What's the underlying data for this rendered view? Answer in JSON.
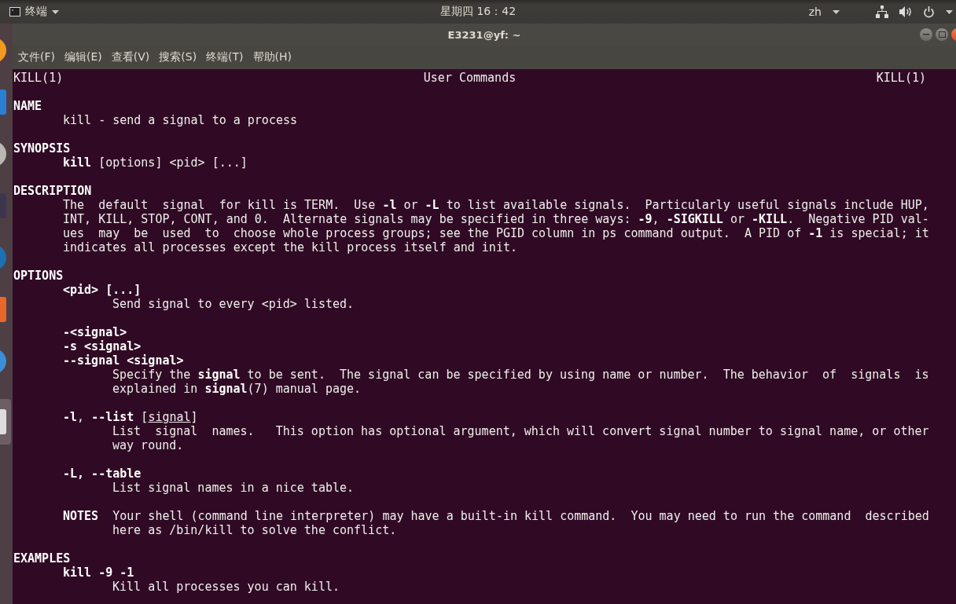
{
  "topbar": {
    "app_menu": "终端",
    "clock": "星期四 16：42",
    "language": "zh"
  },
  "dock": [
    {
      "selected": false
    },
    {
      "selected": false
    },
    {
      "selected": false
    },
    {
      "selected": false
    },
    {
      "selected": false
    },
    {
      "selected": false
    },
    {
      "selected": false
    },
    {
      "selected": true
    }
  ],
  "window": {
    "title": "E3231@yf: ~"
  },
  "menu": [
    "文件(F)",
    "编辑(E)",
    "查看(V)",
    "搜索(S)",
    "终端(T)",
    "帮助(H)"
  ],
  "man": {
    "header": {
      "left": "KILL(1)",
      "center": "User Commands",
      "right": "KILL(1)"
    },
    "sections": [
      {
        "heading": "NAME",
        "blocks": [
          {
            "lines": [
              {
                "kind": "term",
                "bold": false,
                "text": "kill - send a signal to a process"
              }
            ]
          }
        ]
      },
      {
        "heading": "SYNOPSIS",
        "blocks": [
          {
            "lines": [
              {
                "kind": "term",
                "bold": false,
                "text": "**kill** [options] <pid> [...]"
              }
            ]
          }
        ]
      },
      {
        "heading": "DESCRIPTION",
        "blocks": [
          {
            "lines": [
              {
                "kind": "term",
                "bold": false,
                "text": "The  default  signal  for kill is TERM.  Use **-l** or **-L** to list available signals.  Particularly useful signals include HUP,"
              },
              {
                "kind": "term",
                "bold": false,
                "text": "INT, KILL, STOP, CONT, and 0.  Alternate signals may be specified in three ways: **-9**, **-SIGKILL** or **-KILL**.  Negative PID val‐"
              },
              {
                "kind": "term",
                "bold": false,
                "text": "ues  may  be  used  to  choose whole process groups; see the PGID column in ps command output.  A PID of **-1** is special; it"
              },
              {
                "kind": "term",
                "bold": false,
                "text": "indicates all processes except the kill process itself and init."
              }
            ]
          }
        ]
      },
      {
        "heading": "OPTIONS",
        "blocks": [
          {
            "lines": [
              {
                "kind": "term",
                "bold": true,
                "text": "<pid> [...]"
              },
              {
                "kind": "desc",
                "bold": false,
                "text": "Send signal to every <pid> listed."
              }
            ]
          },
          {
            "lines": [
              {
                "kind": "term",
                "bold": true,
                "text": "-<signal>"
              },
              {
                "kind": "term",
                "bold": true,
                "text": "-s <signal>"
              },
              {
                "kind": "term",
                "bold": true,
                "text": "--signal <signal>"
              },
              {
                "kind": "desc",
                "bold": false,
                "text": "Specify the **signal** to be sent.  The signal can be specified by using name or number.  The behavior  of  signals  is"
              },
              {
                "kind": "desc",
                "bold": false,
                "text": "explained in **signal**(7) manual page."
              }
            ]
          },
          {
            "lines": [
              {
                "kind": "term",
                "bold": false,
                "text": "**-l**, **--list** [",
                "arg": "signal",
                "after": "]"
              },
              {
                "kind": "desc",
                "bold": false,
                "text": "List  signal  names.   This option has optional argument, which will convert signal number to signal name, or other"
              },
              {
                "kind": "desc",
                "bold": false,
                "text": "way round."
              }
            ]
          },
          {
            "lines": [
              {
                "kind": "term",
                "bold": true,
                "text": "-L, --table"
              },
              {
                "kind": "desc",
                "bold": false,
                "text": "List signal names in a nice table."
              }
            ]
          },
          {
            "lines": [
              {
                "kind": "term",
                "bold": false,
                "text": "**NOTES**  Your shell (command line interpreter) may have a built-in kill command.  You may need to run the command  described"
              },
              {
                "kind": "desc",
                "bold": false,
                "text": "here as /bin/kill to solve the conflict."
              }
            ]
          }
        ]
      },
      {
        "heading": "EXAMPLES",
        "blocks": [
          {
            "lines": [
              {
                "kind": "term",
                "bold": true,
                "text": "kill -9 -1"
              },
              {
                "kind": "desc",
                "bold": false,
                "text": "Kill all processes you can kill."
              }
            ]
          }
        ]
      }
    ]
  }
}
